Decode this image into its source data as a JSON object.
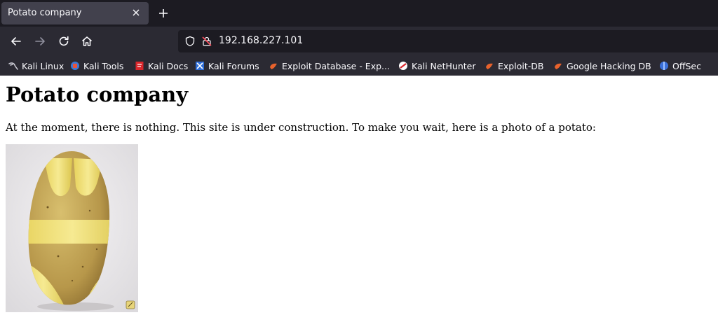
{
  "browser": {
    "tab": {
      "title": "Potato company"
    },
    "url": "192.168.227.101",
    "bookmarks": [
      {
        "label": "Kali Linux",
        "icon": "kali-dragon-icon"
      },
      {
        "label": "Kali Tools",
        "icon": "kali-tools-icon"
      },
      {
        "label": "Kali Docs",
        "icon": "kali-docs-icon"
      },
      {
        "label": "Kali Forums",
        "icon": "kali-forums-icon"
      },
      {
        "label": "Exploit Database - Exp...",
        "icon": "exploit-db-icon"
      },
      {
        "label": "Kali NetHunter",
        "icon": "nethunter-icon"
      },
      {
        "label": "Exploit-DB",
        "icon": "exploit-db-icon"
      },
      {
        "label": "Google Hacking DB",
        "icon": "exploit-db-icon"
      },
      {
        "label": "OffSec",
        "icon": "offsec-icon"
      }
    ]
  },
  "page": {
    "heading": "Potato company",
    "paragraph": "At the moment, there is nothing. This site is under construction. To make you wait, here is a photo of a potato:",
    "photo_icon": "potato-photo"
  },
  "colors": {
    "tabstrip": "#1c1b22",
    "toolbar": "#2b2a33",
    "active_tab": "#42414d",
    "text_light": "#fbfbfe",
    "page_background": "#ffffff"
  }
}
